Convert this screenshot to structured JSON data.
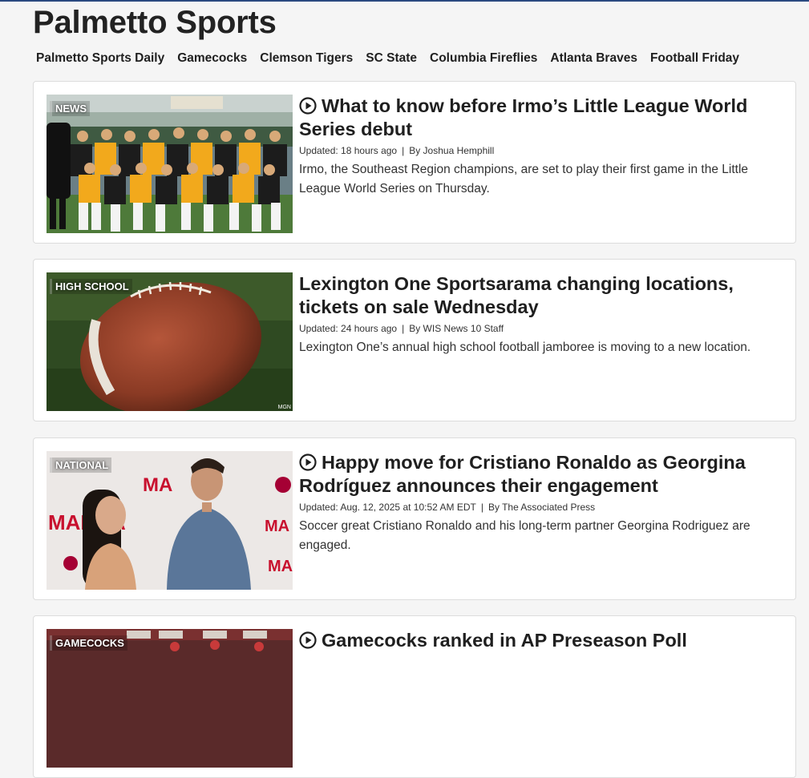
{
  "site": {
    "title": "Palmetto Sports",
    "accent_color": "#2a4a80"
  },
  "nav": [
    "Palmetto Sports Daily",
    "Gamecocks",
    "Clemson Tigers",
    "SC State",
    "Columbia Fireflies",
    "Atlanta Braves",
    "Football Friday"
  ],
  "articles": [
    {
      "category": "NEWS",
      "has_video": true,
      "headline": "What to know before Irmo’s Little League World Series debut",
      "updated": "Updated: 18 hours ago",
      "author": "By Joshua Hemphill",
      "summary": "Irmo, the Southeast Region champions, are set to play their first game in the Little League World Series on Thursday."
    },
    {
      "category": "HIGH SCHOOL",
      "has_video": false,
      "headline": "Lexington One Sportsarama changing locations, tickets on sale Wednesday",
      "updated": "Updated: 24 hours ago",
      "author": "By WIS News 10 Staff",
      "summary": "Lexington One’s annual high school football jamboree is moving to a new location.",
      "image_credit": "MGN"
    },
    {
      "category": "NATIONAL",
      "has_video": true,
      "headline": "Happy move for Cristiano Ronaldo as Georgina Rodríguez announces their engagement",
      "updated": "Updated: Aug. 12, 2025 at 10:52 AM EDT",
      "author": "By The Associated Press",
      "summary": "Soccer great Cristiano Ronaldo and his long-term partner Georgina Rodriguez are engaged."
    },
    {
      "category": "GAMECOCKS",
      "has_video": true,
      "headline": "Gamecocks ranked in AP Preseason Poll"
    }
  ]
}
